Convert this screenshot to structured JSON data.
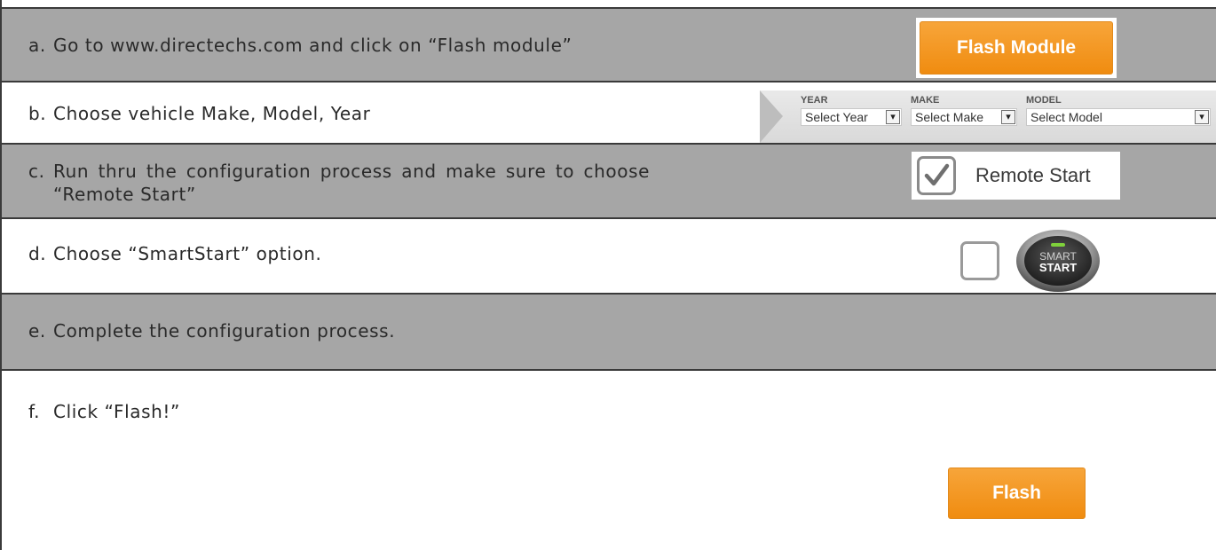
{
  "steps": [
    {
      "letter": "a.",
      "text": "Go to www.directechs.com and click on “Flash module”"
    },
    {
      "letter": "b.",
      "text": "Choose vehicle Make, Model, Year"
    },
    {
      "letter": "c.",
      "text_line1": "Run thru the configuration process and make sure to choose",
      "text_line2": "“Remote Start”"
    },
    {
      "letter": "d.",
      "text": "Choose “SmartStart” option."
    },
    {
      "letter": "e.",
      "text": "Complete the configuration process."
    },
    {
      "letter": "f.",
      "text": "Click “Flash!”"
    }
  ],
  "flash_module_button": {
    "label": "Flash Module"
  },
  "vehicle_selector": {
    "year": {
      "label": "YEAR",
      "value": "Select Year"
    },
    "make": {
      "label": "MAKE",
      "value": "Select Make"
    },
    "model": {
      "label": "MODEL",
      "value": "Select Model"
    }
  },
  "remote_start": {
    "label": "Remote Start",
    "checked": true
  },
  "smartstart": {
    "checked": false,
    "logo_line1": "SMART",
    "logo_line2": "START"
  },
  "flash_button": {
    "label": "Flash"
  },
  "colors": {
    "gray_row": "#a6a6a6",
    "orange_button": "#f39a22",
    "text": "#2a2a2a"
  }
}
